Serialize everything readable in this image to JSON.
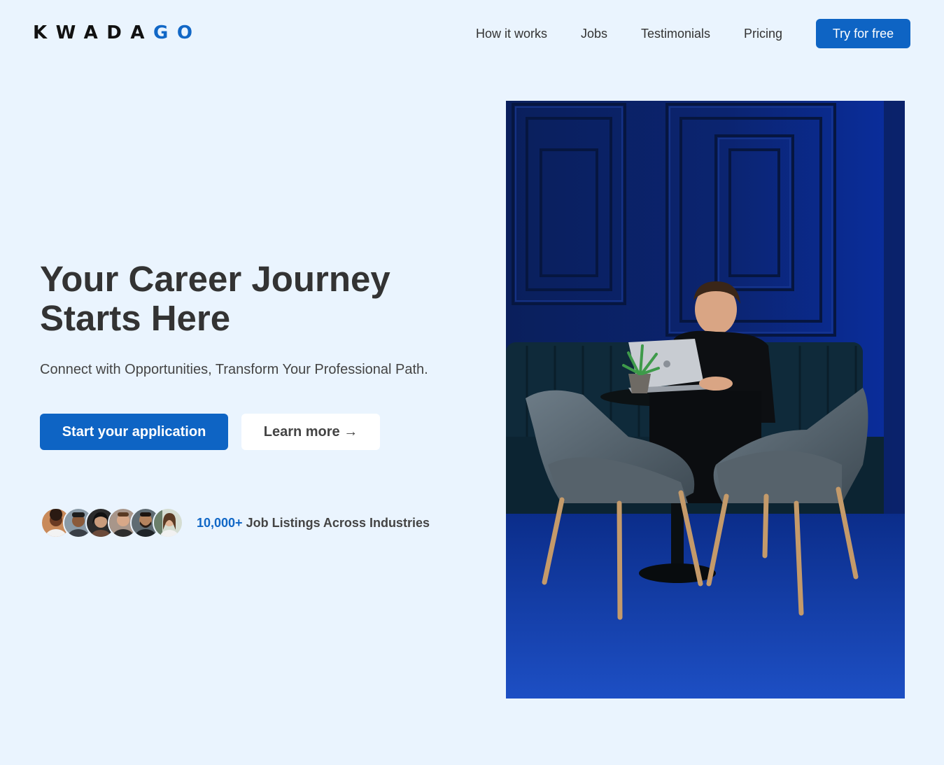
{
  "brand": {
    "logo_main": "KWADA",
    "logo_accent": "GO"
  },
  "nav": {
    "links": [
      "How it works",
      "Jobs",
      "Testimonials",
      "Pricing"
    ],
    "cta": "Try for free"
  },
  "hero": {
    "title_line1": "Your Career Journey",
    "title_line2": "Starts Here",
    "subtitle": "Connect with Opportunities, Transform Your Professional Path.",
    "primary_button": "Start your application",
    "secondary_button": "Learn more →",
    "stat_number": "10,000+",
    "stat_text": " Job Listings Across Industries"
  },
  "colors": {
    "background": "#eaf4fe",
    "accent": "#0e64c4",
    "text": "#333333"
  }
}
